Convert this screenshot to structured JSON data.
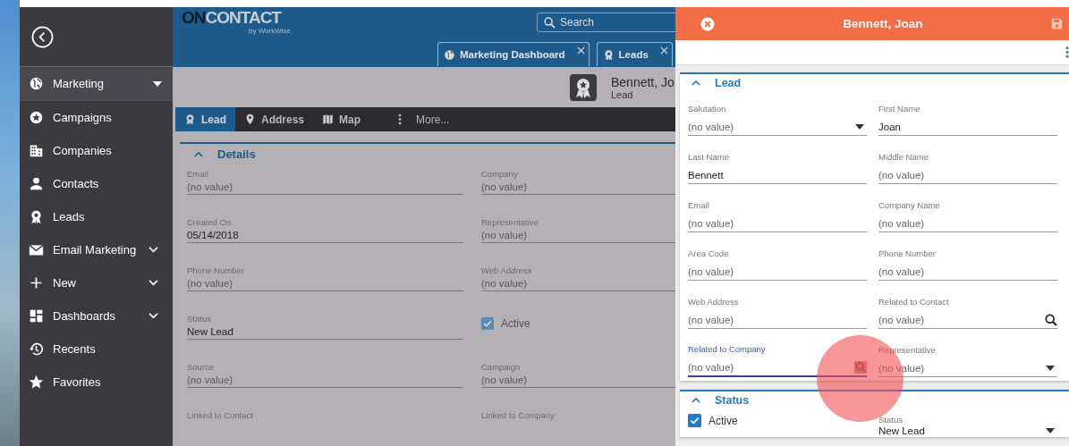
{
  "sidebar": {
    "items": [
      {
        "label": "Marketing",
        "kind": "section",
        "selected": true
      },
      {
        "label": "Campaigns",
        "kind": "link",
        "selected": false
      },
      {
        "label": "Companies",
        "kind": "link",
        "selected": false
      },
      {
        "label": "Contacts",
        "kind": "link",
        "selected": false
      },
      {
        "label": "Leads",
        "kind": "link",
        "selected": false
      },
      {
        "label": "Email Marketing",
        "kind": "group",
        "selected": false
      },
      {
        "label": "New",
        "kind": "group",
        "selected": false
      },
      {
        "label": "Dashboards",
        "kind": "group",
        "selected": false
      },
      {
        "label": "Recents",
        "kind": "link",
        "selected": false
      },
      {
        "label": "Favorites",
        "kind": "link",
        "selected": false
      }
    ]
  },
  "header": {
    "logo": {
      "strong": "ON",
      "light": "CONTACT",
      "byline": "by WorkWise"
    },
    "search": {
      "placeholder": "Search"
    },
    "open_tabs": [
      {
        "label": "Marketing Dashboard"
      },
      {
        "label": "Leads"
      }
    ]
  },
  "record": {
    "title": "Bennett, Jo",
    "subtitle": "Lead"
  },
  "record_tabs": [
    {
      "label": "Lead",
      "selected": true
    },
    {
      "label": "Address",
      "selected": false
    },
    {
      "label": "Map",
      "selected": false
    },
    {
      "label": "More...",
      "selected": false
    }
  ],
  "details": {
    "title": "Details",
    "fields": [
      {
        "kind": "text",
        "label": "Email",
        "placeholder": "(no value)"
      },
      {
        "kind": "text",
        "label": "Company",
        "placeholder": "(no value)"
      },
      {
        "kind": "text",
        "label": "Created On",
        "value": "05/14/2018"
      },
      {
        "kind": "text",
        "label": "Representative",
        "placeholder": "(no value)"
      },
      {
        "kind": "text",
        "label": "Phone Number",
        "placeholder": "(no value)"
      },
      {
        "kind": "text",
        "label": "Web Address",
        "placeholder": "(no value)"
      },
      {
        "kind": "text",
        "label": "Status",
        "value": "New Lead"
      },
      {
        "kind": "checkbox",
        "label": "Active",
        "checked": true
      },
      {
        "kind": "text",
        "label": "Source",
        "placeholder": "(no value)"
      },
      {
        "kind": "text",
        "label": "Campaign",
        "placeholder": "(no value)"
      },
      {
        "kind": "label",
        "label": "Linked to Contact"
      },
      {
        "kind": "label",
        "label": "Linked to Company"
      }
    ]
  },
  "panel": {
    "title": "Bennett, Joan",
    "sections": [
      {
        "title": "Lead",
        "fields": [
          {
            "kind": "select",
            "label": "Salutation",
            "placeholder": "(no value)",
            "focused": false
          },
          {
            "kind": "text",
            "label": "First Name",
            "value": "Joan",
            "focused": false
          },
          {
            "kind": "text",
            "label": "Last Name",
            "value": "Bennett",
            "focused": false
          },
          {
            "kind": "text",
            "label": "Middle Name",
            "placeholder": "(no value)",
            "focused": false
          },
          {
            "kind": "text",
            "label": "Email",
            "placeholder": "(no value)",
            "focused": false
          },
          {
            "kind": "text",
            "label": "Company Name",
            "placeholder": "(no value)",
            "focused": false
          },
          {
            "kind": "text",
            "label": "Area Code",
            "placeholder": "(no value)",
            "focused": false
          },
          {
            "kind": "text",
            "label": "Phone Number",
            "placeholder": "(no value)",
            "focused": false
          },
          {
            "kind": "text",
            "label": "Web Address",
            "placeholder": "(no value)",
            "focused": false
          },
          {
            "kind": "lookup",
            "label": "Related to Contact",
            "placeholder": "(no value)",
            "focused": false
          },
          {
            "kind": "lookup",
            "label": "Related to Company",
            "placeholder": "(no value)",
            "focused": true
          },
          {
            "kind": "select",
            "label": "Representative",
            "placeholder": "(no value)",
            "focused": false
          }
        ]
      },
      {
        "title": "Status",
        "fields": [
          {
            "kind": "checkbox",
            "label": "Active",
            "checked": true
          },
          {
            "kind": "select",
            "label": "Status",
            "value": "New Lead",
            "focused": false
          }
        ]
      }
    ]
  }
}
